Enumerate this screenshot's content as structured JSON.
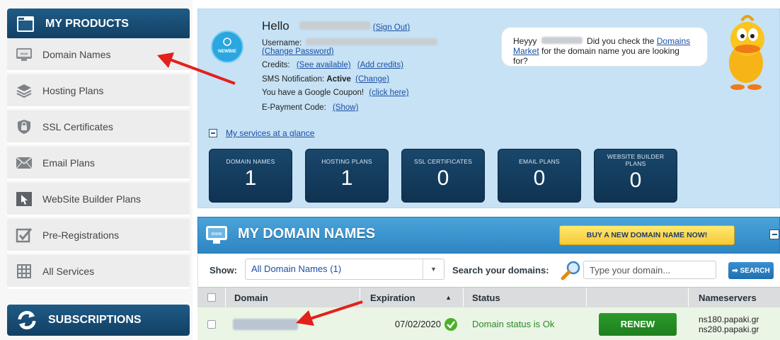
{
  "colors": {
    "sidebar_header": "#1f5b86",
    "panel_bg": "#c7e2f5",
    "tile_bg": "#19476b",
    "section_header": "#2d86c3",
    "buy_button": "#f6c936",
    "renew_button": "#2a9b2a",
    "status_ok": "#2a9b2a",
    "annotation_arrow": "#e3201b"
  },
  "sidebar": {
    "products_title": "MY PRODUCTS",
    "subscriptions_title": "SUBSCRIPTIONS",
    "items": [
      {
        "label": "Domain Names",
        "icon": "monitor-icon"
      },
      {
        "label": "Hosting Plans",
        "icon": "layers-icon"
      },
      {
        "label": "SSL Certificates",
        "icon": "lock-icon"
      },
      {
        "label": "Email Plans",
        "icon": "envelope-icon"
      },
      {
        "label": "WebSite Builder Plans",
        "icon": "cursor-icon"
      },
      {
        "label": "Pre-Registrations",
        "icon": "checkbox-icon"
      },
      {
        "label": "All Services",
        "icon": "grid-icon"
      }
    ]
  },
  "account": {
    "hello": "Hello",
    "sign_out": "(Sign Out)",
    "badge": "NEWBIE",
    "username_label": "Username:",
    "change_password": "(Change Password)",
    "credits_label": "Credits:",
    "see_available": "(See available)",
    "add_credits": "(Add credits)",
    "sms_label": "SMS Notification:",
    "sms_status": "Active",
    "sms_change": "(Change)",
    "coupon_text": "You have a Google Coupon!",
    "coupon_link": "(click here)",
    "epayment_label": "E-Payment Code:",
    "epayment_link": "(Show)"
  },
  "bubble": {
    "greeting": "Heyyy",
    "text1": "Did you check the",
    "link": "Domains Market",
    "text2": "for the domain name you are looking for?"
  },
  "glance": {
    "label": "My services at a glance",
    "tiles": [
      {
        "label": "DOMAIN NAMES",
        "count": "1"
      },
      {
        "label": "HOSTING PLANS",
        "count": "1"
      },
      {
        "label": "SSL CERTIFICATES",
        "count": "0"
      },
      {
        "label": "EMAIL PLANS",
        "count": "0"
      },
      {
        "label": "WEBSITE BUILDER PLANS",
        "count": "0"
      }
    ]
  },
  "domains": {
    "title": "MY DOMAIN NAMES",
    "buy_button": "BUY A NEW DOMAIN NAME NOW!",
    "show_label": "Show:",
    "show_value": "All Domain Names (1)",
    "search_label": "Search your domains:",
    "search_placeholder": "Type your domain...",
    "search_button": "➡ SEARCH",
    "columns": [
      "Domain",
      "Expiration",
      "Status",
      "",
      "Nameservers"
    ],
    "rows": [
      {
        "expiration": "07/02/2020",
        "status": "Domain status is Ok",
        "action": "RENEW",
        "ns1": "ns180.papaki.gr",
        "ns2": "ns280.papaki.gr"
      }
    ]
  }
}
